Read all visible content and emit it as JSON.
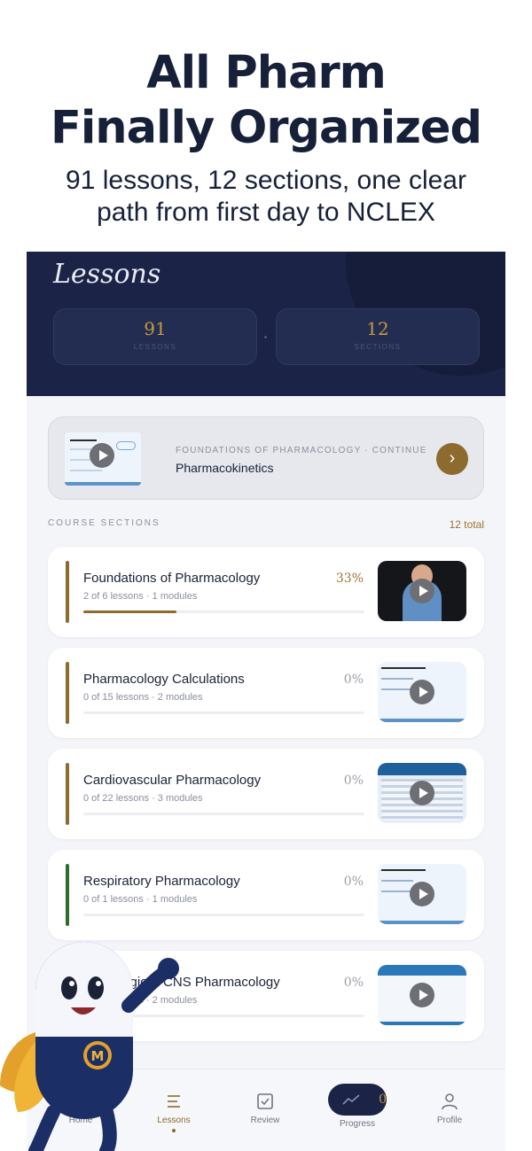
{
  "headline": {
    "line1": "All Pharm",
    "line2": "Finally Organized"
  },
  "subhead": {
    "line1": "91 lessons, 12 sections, one clear",
    "line2": "path from first day to NCLEX"
  },
  "app": {
    "title": "Lessons",
    "stats": [
      {
        "value": "91",
        "label": "LESSONS"
      },
      {
        "value": "12",
        "label": "SECTIONS"
      }
    ],
    "continue": {
      "meta": "FOUNDATIONS OF PHARMACOLOGY · CONTINUE",
      "title": "Pharmacokinetics",
      "arrow": "›"
    },
    "sections_label": "COURSE SECTIONS",
    "sections_count": "12 total",
    "sections": [
      {
        "title": "Foundations of Pharmacology",
        "subtitle": "2 of 6 lessons · 1 modules",
        "percent": "33%",
        "progress": 0.33,
        "accent": "#8d6a2e",
        "thumb": "video-instructor"
      },
      {
        "title": "Pharmacology Calculations",
        "subtitle": "0 of 15 lessons · 2 modules",
        "percent": "0%",
        "progress": 0,
        "accent": "#8d6a2e",
        "thumb": "slide-formulas"
      },
      {
        "title": "Cardiovascular Pharmacology",
        "subtitle": "0 of 22 lessons · 3 modules",
        "percent": "0%",
        "progress": 0,
        "accent": "#8d6a2e",
        "thumb": "slide-table"
      },
      {
        "title": "Respiratory Pharmacology",
        "subtitle": "0 of 1 lessons · 1 modules",
        "percent": "0%",
        "progress": 0,
        "accent": "#2e6b2e",
        "thumb": "slide-text"
      },
      {
        "title": "Neurologic & CNS Pharmacology",
        "subtitle": "0 of 9 lessons · 2 modules",
        "percent": "0%",
        "progress": 0,
        "accent": "#8d6a2e",
        "thumb": "slide-benzo"
      }
    ],
    "tabs": [
      {
        "label": "Home",
        "icon": "home-icon"
      },
      {
        "label": "Lessons",
        "icon": "list-icon"
      },
      {
        "label": "Review",
        "icon": "checkbox-icon"
      },
      {
        "label": "Progress",
        "icon": "trend-icon",
        "count": "0"
      },
      {
        "label": "Profile",
        "icon": "person-icon"
      }
    ]
  },
  "colors": {
    "navy": "#1b2446",
    "gold": "#8d6a2e",
    "accent_gold": "#c79a3c"
  }
}
